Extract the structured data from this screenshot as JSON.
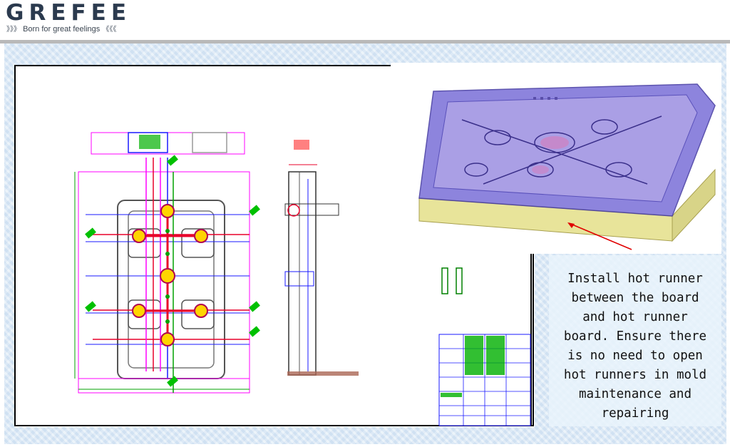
{
  "header": {
    "brand": "GREFEE",
    "tagline": "Born for great feelings",
    "tagline_prefix": "》》》",
    "tagline_suffix": "《《《"
  },
  "caption": {
    "text": "Install hot runner\nbetween the board\nand hot runner\nboard. Ensure there\nis no need to open\nhot runners in mold\nmaintenance and\nrepairing"
  },
  "colors": {
    "cad_magenta": "#ff00ff",
    "cad_red": "#e8002a",
    "cad_blue": "#1a1aff",
    "cad_green": "#00c000",
    "cad_yellow": "#ffd400",
    "mold_purple": "#6a5cc8",
    "mold_yellow": "#e8e49a",
    "annotation_red": "#e00000"
  },
  "icons": {
    "drawing": "cad-drawing-icon",
    "render": "mold-3d-render-icon",
    "arrow": "annotation-arrow-icon"
  }
}
